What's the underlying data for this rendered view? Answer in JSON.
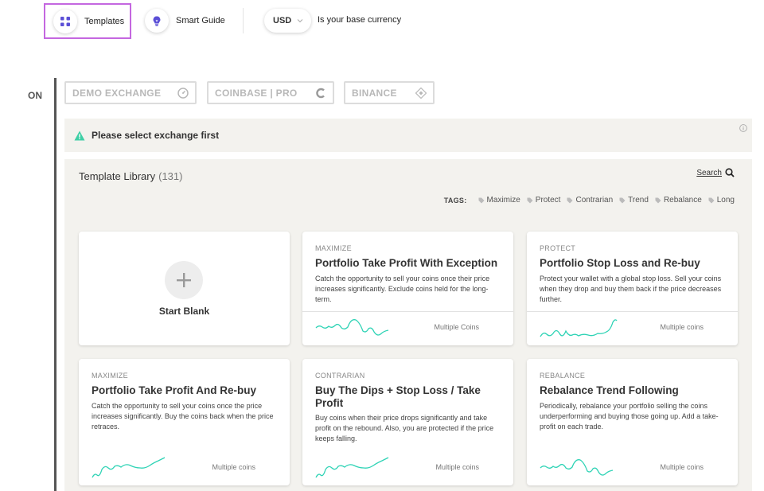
{
  "toolbar": {
    "templates_label": "Templates",
    "guide_label": "Smart Guide",
    "currency": "USD",
    "currency_note": "Is your base currency"
  },
  "status": {
    "on_label": "ON"
  },
  "exchanges": [
    {
      "name": "DEMO EXCHANGE",
      "icon": "speedometer-icon"
    },
    {
      "name": "COINBASE | PRO",
      "icon": "coinbase-c-icon"
    },
    {
      "name": "BINANCE",
      "icon": "binance-diamond-icon"
    }
  ],
  "alert": {
    "text": "Please select exchange first",
    "icon": "warning-triangle-icon"
  },
  "library": {
    "title": "Template Library",
    "count": "(131)",
    "search_label": "Search",
    "tags_label": "TAGS:",
    "tags": [
      "Maximize",
      "Protect",
      "Contrarian",
      "Trend",
      "Rebalance",
      "Long"
    ]
  },
  "cards": {
    "blank": {
      "label": "Start Blank"
    },
    "c1": {
      "category": "MAXIMIZE",
      "title": "Portfolio Take Profit With Exception",
      "desc": "Catch the opportunity to sell your coins once their price increases significantly. Exclude coins held for the long-term.",
      "coins": "Multiple Coins"
    },
    "c2": {
      "category": "PROTECT",
      "title": "Portfolio Stop Loss and Re-buy",
      "desc": "Protect your wallet with a global stop loss. Sell your coins when they drop and buy them back if the price decreases further.",
      "coins": "Multiple coins"
    },
    "c3": {
      "category": "MAXIMIZE",
      "title": "Portfolio Take Profit And Re-buy",
      "desc": "Catch the opportunity to sell your coins once the price increases significantly. Buy the coins back when the price retraces.",
      "coins": "Multiple coins"
    },
    "c4": {
      "category": "CONTRARIAN",
      "title": "Buy The Dips + Stop Loss / Take Profit",
      "desc": "Buy coins when their price drops significantly and take profit on the rebound. Also, you are protected if the price keeps falling.",
      "coins": "Multiple coins"
    },
    "c5": {
      "category": "REBALANCE",
      "title": "Rebalance Trend Following",
      "desc": "Periodically, rebalance your portfolio selling the coins underperforming and buying those going up. Add a take-profit on each trade.",
      "coins": "Multiple coins"
    }
  },
  "colors": {
    "accent": "#5b4fd6",
    "selection_border": "#c467e0",
    "sparkline": "#2ed3b5",
    "alert_icon": "#3ecfa5",
    "panel_bg": "#f3f2ee"
  }
}
